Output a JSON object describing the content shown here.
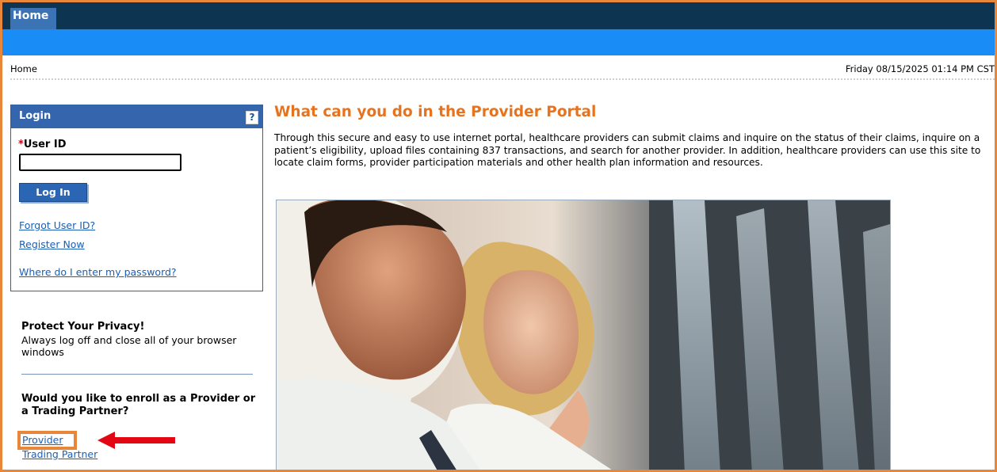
{
  "header": {
    "home_tab": "Home"
  },
  "breadcrumb": "Home",
  "datetime": "Friday 08/15/2025 01:14 PM CST",
  "login": {
    "title": "Login",
    "help_label": "?",
    "user_id_required_mark": "*",
    "user_id_label": "User ID",
    "user_id_value": "",
    "login_button": "Log In",
    "forgot_user_id": "Forgot User ID?",
    "register_now": "Register Now",
    "where_password": "Where do I enter my password?"
  },
  "privacy": {
    "title": "Protect Your Privacy!",
    "text": "Always log off and close all of your browser windows"
  },
  "enroll": {
    "question": "Would you like to enroll as a Provider or a Trading Partner?",
    "provider_link": "Provider",
    "trading_partner_link": "Trading Partner"
  },
  "main": {
    "title": "What can you do in the Provider Portal",
    "intro": "Through this secure and easy to use internet portal, healthcare providers can submit claims and inquire on the status of their claims, inquire on a patient’s eligibility, upload files containing 837 transactions, and search for another provider. In addition, healthcare providers can use this site to locate claim forms, provider participation materials and other health plan information and resources."
  },
  "colors": {
    "highlight_border": "#e8873a",
    "arrow": "#e30613",
    "title": "#e8731e",
    "link": "#1b5fb4"
  },
  "icons": {
    "help": "help-icon",
    "annotation_arrow": "arrow-left-icon"
  }
}
